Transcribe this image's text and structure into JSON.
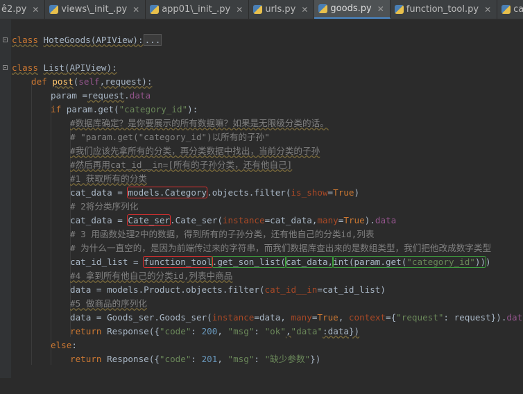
{
  "tabs": [
    {
      "label": "ê2.py",
      "active": false
    },
    {
      "label": "views\\_init_.py",
      "active": false
    },
    {
      "label": "app01\\_init_.py",
      "active": false
    },
    {
      "label": "urls.py",
      "active": false
    },
    {
      "label": "goods.py",
      "active": true
    },
    {
      "label": "function_tool.py",
      "active": false
    },
    {
      "label": "category.",
      "active": false
    }
  ],
  "code": {
    "l1": {
      "kw": "class",
      "name": "HoteGoods",
      "base": "(APIView):",
      "collapsed": "..."
    },
    "l2": {
      "kw": "class",
      "name": "List",
      "base": "(APIView):"
    },
    "l3": {
      "kw": "def",
      "fn": "post",
      "open": "(",
      "self": "self",
      "rest": ",request):"
    },
    "l4": {
      "a": "param =",
      "b": "request",
      "c": ".",
      "d": "data"
    },
    "l5": {
      "kw": "if",
      "a": " param.get(",
      "s": "\"category_id\"",
      "b": "):"
    },
    "l6": "#数据库确定？是你要展示的所有数据嘛？如果是无限级分类的话。",
    "l7": "# \"param.get(\"category_id\")以所有的子孙\"",
    "l8": "#我们应该先拿所有的分类，再分类数据中找出，当前分类的子孙",
    "l9": "#然后再用cat_id__in=[所有的子孙分类，还有他自己]",
    "l10": "#1 获取所有的分类",
    "l11": {
      "a": "cat_data = ",
      "box": "models.Category",
      "b": ".objects.filter(",
      "p": "is_show",
      "c": "=",
      "kw": "True",
      "d": ")"
    },
    "l12": "# 2将分类序列化",
    "l13": {
      "a": "cat_data = ",
      "box": "Cate_ser",
      "b": ".Cate_ser(",
      "p1": "instance",
      "c": "=cat_data,",
      "p2": "many",
      "d": "=",
      "kw": "True",
      "e": ").",
      "f": "data"
    },
    "l14": "# 3 用函数处理2中的数据，得到所有的子孙分类，还有他自己的分类id,列表",
    "l15": "# 为什么一直空的，是因为前端传过来的字符串，而我们数据库查出来的是数组类型，我们把他改成数字类型",
    "l16": {
      "a": "cat_id_list = ",
      "box1": "function_tool",
      "g1": ".get_son_list(",
      "g2": "cat_data,",
      "g3": "int(param.get(",
      "s": "\"category_id\"",
      "g4": "))",
      "e": ")"
    },
    "l17": "#4 拿到所有他自己的分类id,列表中商品",
    "l18": {
      "a": "data = models.Product.objects.filter(",
      "p": "cat_id__in",
      "b": "=cat_id_list)"
    },
    "l19": "#5 做商品的序列化",
    "l20": {
      "a": "data = Goods_ser.Goods_ser(",
      "p1": "instance",
      "b": "=data, ",
      "p2": "many",
      "c": "=",
      "kw": "True",
      "d": ", ",
      "p3": "context",
      "e": "={",
      "s": "\"request\"",
      "f": ": request}).",
      "g": "data"
    },
    "l21": {
      "kw": "return",
      "a": " Response({",
      "s1": "\"code\"",
      "b": ": ",
      "n": "200",
      "c": ", ",
      "s2": "\"msg\"",
      "d": ": ",
      "s3": "\"ok\"",
      "e": ",",
      "s4": "\"data\"",
      "f": ":data})"
    },
    "l22": {
      "kw": "else",
      "a": ":"
    },
    "l23": {
      "kw": "return",
      "a": " Response({",
      "s1": "\"code\"",
      "b": ": ",
      "n": "201",
      "c": ", ",
      "s2": "\"msg\"",
      "d": ": ",
      "s3": "\"缺少参数\"",
      "e": "})"
    }
  }
}
